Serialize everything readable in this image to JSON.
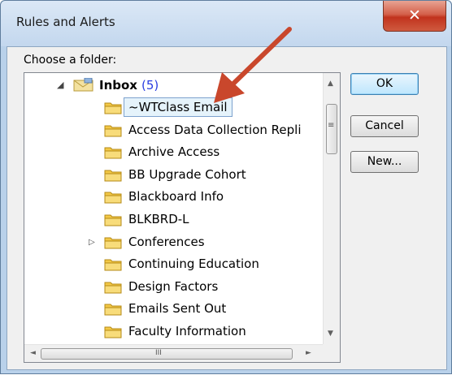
{
  "window": {
    "title": "Rules and Alerts",
    "close_glyph": "✕"
  },
  "dialog": {
    "folder_label": "Choose a folder:",
    "root": {
      "name": "Inbox",
      "count": "(5)",
      "expander": "◢"
    },
    "folders": [
      {
        "name": "~WTClass Email",
        "selected": true
      },
      {
        "name": "Access Data Collection Repli"
      },
      {
        "name": "Archive Access"
      },
      {
        "name": "BB Upgrade Cohort"
      },
      {
        "name": "Blackboard Info"
      },
      {
        "name": "BLKBRD-L"
      },
      {
        "name": "Conferences",
        "expander": "▷"
      },
      {
        "name": "Continuing Education"
      },
      {
        "name": "Design Factors"
      },
      {
        "name": "Emails Sent Out"
      },
      {
        "name": "Faculty Information"
      }
    ],
    "buttons": {
      "ok": "OK",
      "cancel": "Cancel",
      "new": "New..."
    }
  },
  "scrollbar": {
    "up": "▲",
    "down": "▼",
    "left": "◄",
    "right": "►",
    "vgrip": "≡",
    "hgrip": "III"
  },
  "colors": {
    "accent_arrow": "#c9472c",
    "selection": "#e5f3fb",
    "folder": "#f3c846"
  }
}
